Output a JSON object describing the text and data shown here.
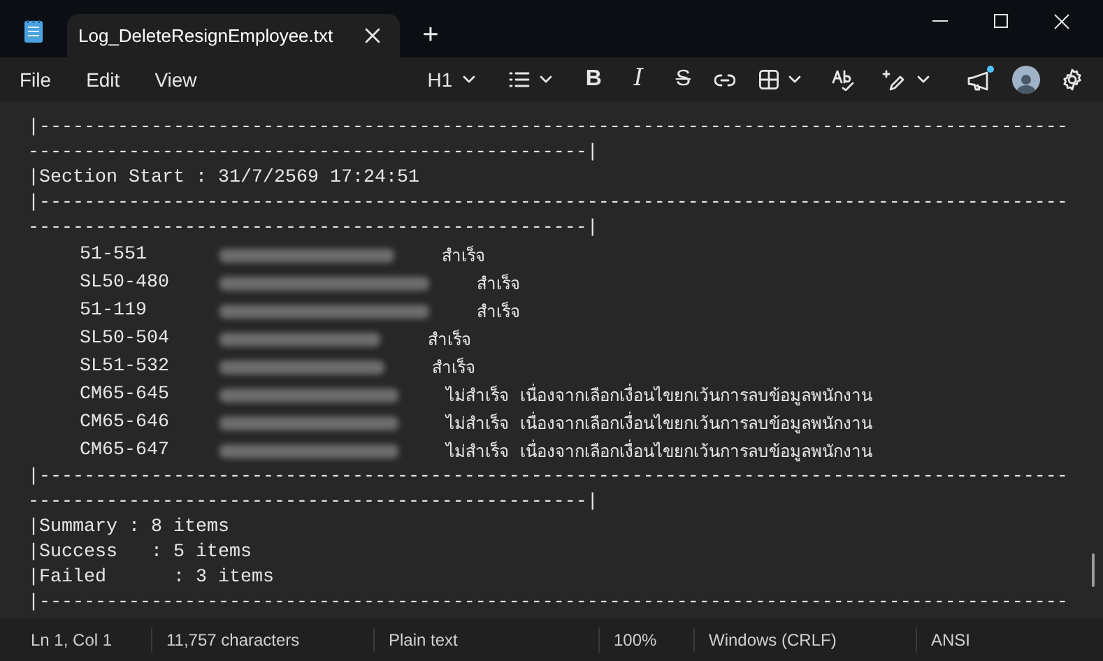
{
  "window": {
    "tab_title": "Log_DeleteResignEmployee.txt",
    "new_tab": "+"
  },
  "menu": [
    "File",
    "Edit",
    "View"
  ],
  "toolbar": {
    "heading": "H1",
    "bold": "B",
    "italic": "I",
    "strike": "S"
  },
  "lines": [
    {
      "kind": "rule",
      "text": "|----------------------------------------------------------------------------------------------------------------------------------------------|"
    },
    {
      "kind": "text",
      "text": "|Section Start : 31/7/2569 17:24:51"
    },
    {
      "kind": "rule",
      "text": "|----------------------------------------------------------------------------------------------------------------------------------------------|"
    },
    {
      "kind": "entry",
      "code": "51-551",
      "status": "สำเร็จ"
    },
    {
      "kind": "entry",
      "code": "SL50-480",
      "status": "สำเร็จ"
    },
    {
      "kind": "entry",
      "code": "51-119",
      "status": "สำเร็จ"
    },
    {
      "kind": "entry",
      "code": "SL50-504",
      "status": "สำเร็จ"
    },
    {
      "kind": "entry",
      "code": "SL51-532",
      "status": "สำเร็จ"
    },
    {
      "kind": "entry",
      "code": "CM65-645",
      "status": "ไม่สำเร็จ",
      "reason": "เนื่องจากเลือกเงื่อนไขยกเว้นการลบข้อมูลพนักงาน"
    },
    {
      "kind": "entry",
      "code": "CM65-646",
      "status": "ไม่สำเร็จ",
      "reason": "เนื่องจากเลือกเงื่อนไขยกเว้นการลบข้อมูลพนักงาน"
    },
    {
      "kind": "entry",
      "code": "CM65-647",
      "status": "ไม่สำเร็จ",
      "reason": "เนื่องจากเลือกเงื่อนไขยกเว้นการลบข้อมูลพนักงาน"
    },
    {
      "kind": "rule",
      "text": "|----------------------------------------------------------------------------------------------------------------------------------------------|"
    },
    {
      "kind": "text",
      "text": "|Summary : 8 items"
    },
    {
      "kind": "text",
      "text": "|Success   : 5 items"
    },
    {
      "kind": "text",
      "text": "|Failed      : 3 items"
    },
    {
      "kind": "rule",
      "text": "|--------------------------------------------------------------------------------------------"
    }
  ],
  "status_bar": [
    "Ln 1, Col 1",
    "11,757 characters",
    "Plain text",
    "100%",
    "Windows (CRLF)",
    "ANSI"
  ]
}
